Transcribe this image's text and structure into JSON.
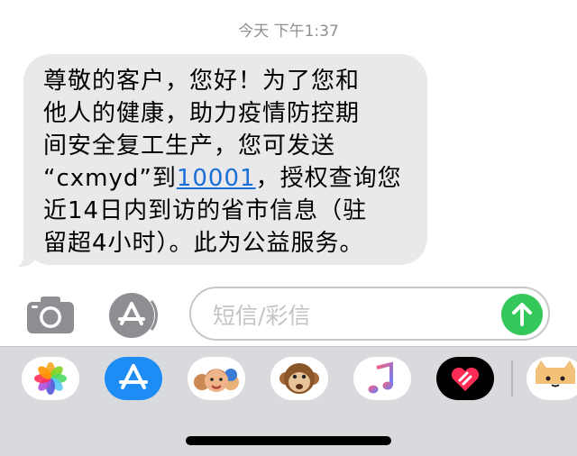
{
  "header": {
    "timestamp": "今天 下午1:37"
  },
  "message": {
    "lines": [
      {
        "before": "尊敬的客户，您好！为了您和",
        "link": "",
        "after": ""
      },
      {
        "before": "他人的健康，助力疫情防控期",
        "link": "",
        "after": ""
      },
      {
        "before": "间安全复工生产，您可发送",
        "link": "",
        "after": ""
      },
      {
        "before": "“cxmyd”到",
        "link": "10001",
        "after": "，授权查询您"
      },
      {
        "before": "近14日内到访的省市信息（驻",
        "link": "",
        "after": ""
      },
      {
        "before": "留超4小时）。此为公益服务。",
        "link": "",
        "after": ""
      }
    ]
  },
  "composer": {
    "placeholder": "短信/彩信",
    "value": ""
  },
  "app_drawer": {
    "apps": [
      {
        "name": "photos-icon"
      },
      {
        "name": "app-store-icon"
      },
      {
        "name": "memoji-icon"
      },
      {
        "name": "monkey-animoji-icon"
      },
      {
        "name": "music-icon"
      },
      {
        "name": "digital-touch-icon"
      },
      {
        "name": "cat-sticker-icon"
      }
    ]
  },
  "colors": {
    "bubble": "#e9e9eb",
    "link": "#1a6fd6",
    "send": "#34c759",
    "drawer": "#d8dadd"
  }
}
